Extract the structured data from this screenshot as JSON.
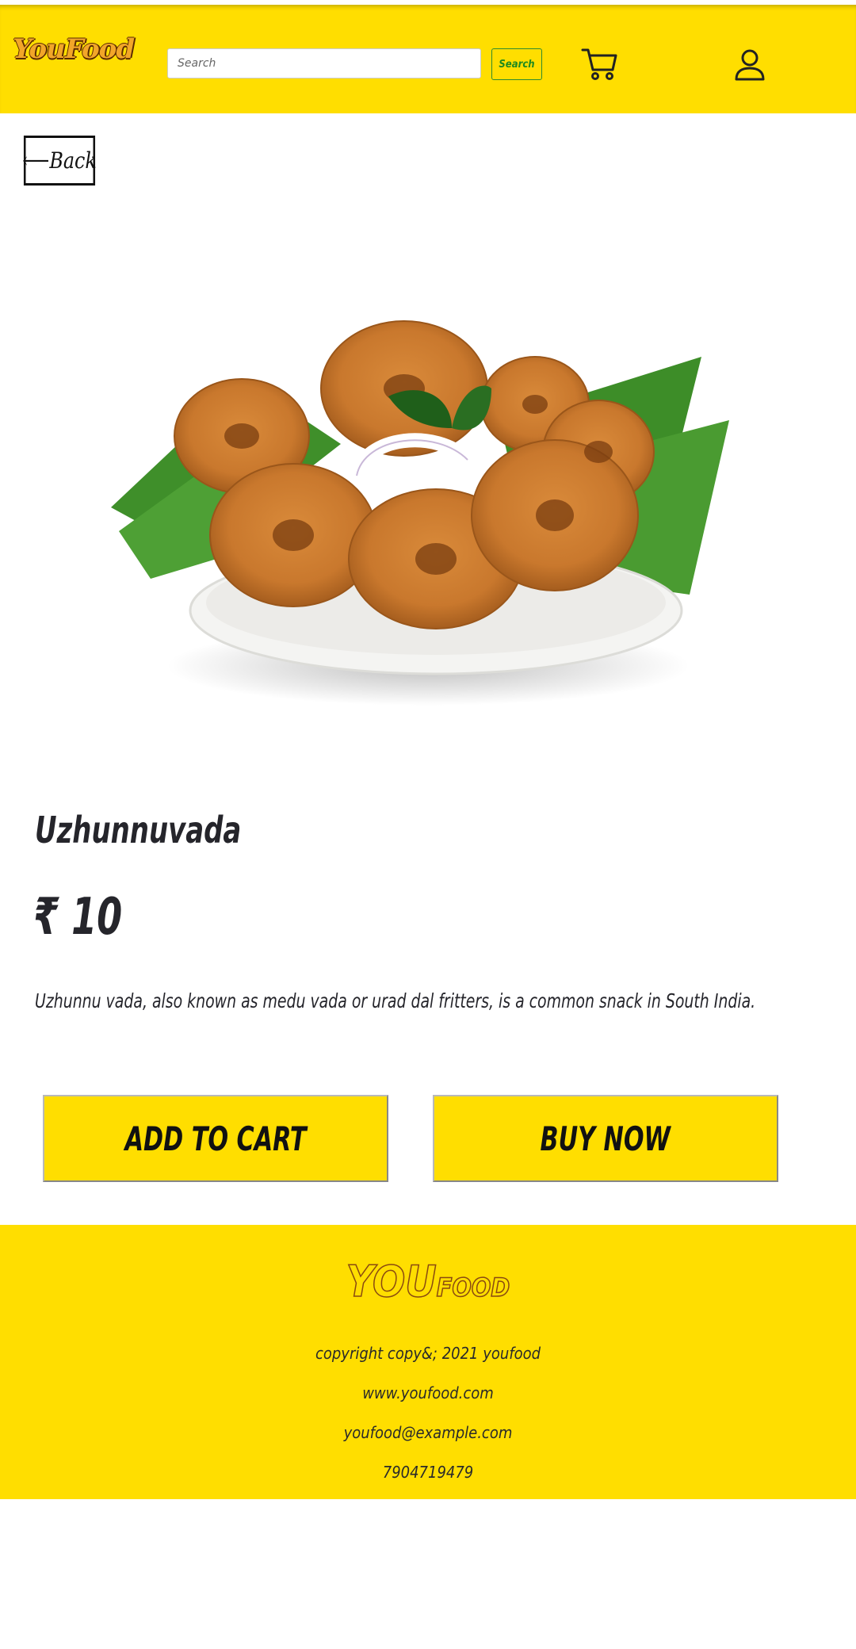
{
  "header": {
    "logo_text": "YouFood",
    "search_placeholder": "Search",
    "search_button_label": "Search",
    "cart_icon": "cart-icon",
    "user_icon": "user-icon"
  },
  "back_button": {
    "label": "⟵Back"
  },
  "product": {
    "name": "Uzhunnuvada",
    "price": "₹ 10",
    "description": "Uzhunnu vada, also known as medu vada or urad dal fritters, is a common snack in South India.",
    "image_alt": "Plate of uzhunnu vada on banana leaf"
  },
  "actions": {
    "add_to_cart": "ADD TO CART",
    "buy_now": "BUY NOW"
  },
  "footer": {
    "brand_you": "YOU",
    "brand_food": "FOOD",
    "copyright": "copyright copy&; 2021 youfood",
    "website": "www.youfood.com",
    "email": "youfood@example.com",
    "phone": "7904719479"
  },
  "colors": {
    "brand_yellow": "#ffde00",
    "text_dark": "#25252b",
    "search_button_green": "#1f8a1f"
  }
}
